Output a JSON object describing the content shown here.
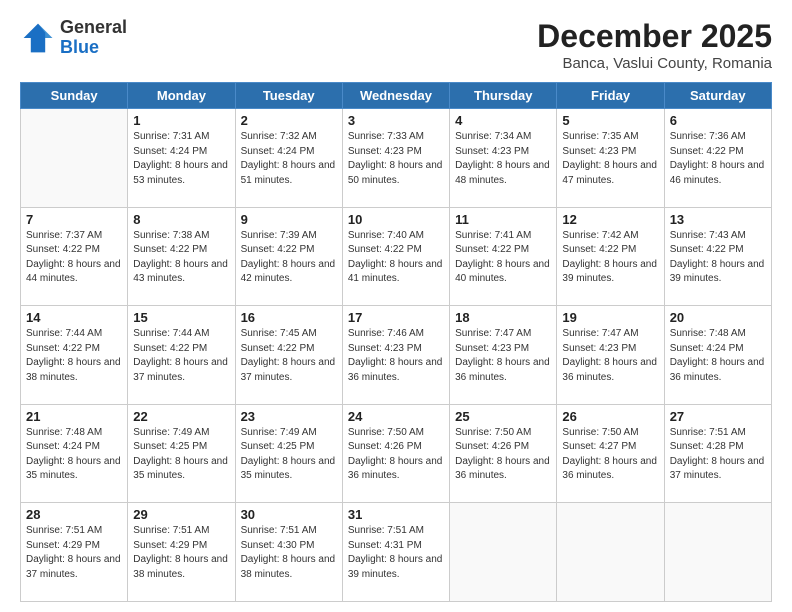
{
  "header": {
    "logo_general": "General",
    "logo_blue": "Blue",
    "title": "December 2025",
    "subtitle": "Banca, Vaslui County, Romania"
  },
  "days_of_week": [
    "Sunday",
    "Monday",
    "Tuesday",
    "Wednesday",
    "Thursday",
    "Friday",
    "Saturday"
  ],
  "weeks": [
    [
      {
        "day": "",
        "sunrise": "",
        "sunset": "",
        "daylight": ""
      },
      {
        "day": "1",
        "sunrise": "Sunrise: 7:31 AM",
        "sunset": "Sunset: 4:24 PM",
        "daylight": "Daylight: 8 hours and 53 minutes."
      },
      {
        "day": "2",
        "sunrise": "Sunrise: 7:32 AM",
        "sunset": "Sunset: 4:24 PM",
        "daylight": "Daylight: 8 hours and 51 minutes."
      },
      {
        "day": "3",
        "sunrise": "Sunrise: 7:33 AM",
        "sunset": "Sunset: 4:23 PM",
        "daylight": "Daylight: 8 hours and 50 minutes."
      },
      {
        "day": "4",
        "sunrise": "Sunrise: 7:34 AM",
        "sunset": "Sunset: 4:23 PM",
        "daylight": "Daylight: 8 hours and 48 minutes."
      },
      {
        "day": "5",
        "sunrise": "Sunrise: 7:35 AM",
        "sunset": "Sunset: 4:23 PM",
        "daylight": "Daylight: 8 hours and 47 minutes."
      },
      {
        "day": "6",
        "sunrise": "Sunrise: 7:36 AM",
        "sunset": "Sunset: 4:22 PM",
        "daylight": "Daylight: 8 hours and 46 minutes."
      }
    ],
    [
      {
        "day": "7",
        "sunrise": "Sunrise: 7:37 AM",
        "sunset": "Sunset: 4:22 PM",
        "daylight": "Daylight: 8 hours and 44 minutes."
      },
      {
        "day": "8",
        "sunrise": "Sunrise: 7:38 AM",
        "sunset": "Sunset: 4:22 PM",
        "daylight": "Daylight: 8 hours and 43 minutes."
      },
      {
        "day": "9",
        "sunrise": "Sunrise: 7:39 AM",
        "sunset": "Sunset: 4:22 PM",
        "daylight": "Daylight: 8 hours and 42 minutes."
      },
      {
        "day": "10",
        "sunrise": "Sunrise: 7:40 AM",
        "sunset": "Sunset: 4:22 PM",
        "daylight": "Daylight: 8 hours and 41 minutes."
      },
      {
        "day": "11",
        "sunrise": "Sunrise: 7:41 AM",
        "sunset": "Sunset: 4:22 PM",
        "daylight": "Daylight: 8 hours and 40 minutes."
      },
      {
        "day": "12",
        "sunrise": "Sunrise: 7:42 AM",
        "sunset": "Sunset: 4:22 PM",
        "daylight": "Daylight: 8 hours and 39 minutes."
      },
      {
        "day": "13",
        "sunrise": "Sunrise: 7:43 AM",
        "sunset": "Sunset: 4:22 PM",
        "daylight": "Daylight: 8 hours and 39 minutes."
      }
    ],
    [
      {
        "day": "14",
        "sunrise": "Sunrise: 7:44 AM",
        "sunset": "Sunset: 4:22 PM",
        "daylight": "Daylight: 8 hours and 38 minutes."
      },
      {
        "day": "15",
        "sunrise": "Sunrise: 7:44 AM",
        "sunset": "Sunset: 4:22 PM",
        "daylight": "Daylight: 8 hours and 37 minutes."
      },
      {
        "day": "16",
        "sunrise": "Sunrise: 7:45 AM",
        "sunset": "Sunset: 4:22 PM",
        "daylight": "Daylight: 8 hours and 37 minutes."
      },
      {
        "day": "17",
        "sunrise": "Sunrise: 7:46 AM",
        "sunset": "Sunset: 4:23 PM",
        "daylight": "Daylight: 8 hours and 36 minutes."
      },
      {
        "day": "18",
        "sunrise": "Sunrise: 7:47 AM",
        "sunset": "Sunset: 4:23 PM",
        "daylight": "Daylight: 8 hours and 36 minutes."
      },
      {
        "day": "19",
        "sunrise": "Sunrise: 7:47 AM",
        "sunset": "Sunset: 4:23 PM",
        "daylight": "Daylight: 8 hours and 36 minutes."
      },
      {
        "day": "20",
        "sunrise": "Sunrise: 7:48 AM",
        "sunset": "Sunset: 4:24 PM",
        "daylight": "Daylight: 8 hours and 36 minutes."
      }
    ],
    [
      {
        "day": "21",
        "sunrise": "Sunrise: 7:48 AM",
        "sunset": "Sunset: 4:24 PM",
        "daylight": "Daylight: 8 hours and 35 minutes."
      },
      {
        "day": "22",
        "sunrise": "Sunrise: 7:49 AM",
        "sunset": "Sunset: 4:25 PM",
        "daylight": "Daylight: 8 hours and 35 minutes."
      },
      {
        "day": "23",
        "sunrise": "Sunrise: 7:49 AM",
        "sunset": "Sunset: 4:25 PM",
        "daylight": "Daylight: 8 hours and 35 minutes."
      },
      {
        "day": "24",
        "sunrise": "Sunrise: 7:50 AM",
        "sunset": "Sunset: 4:26 PM",
        "daylight": "Daylight: 8 hours and 36 minutes."
      },
      {
        "day": "25",
        "sunrise": "Sunrise: 7:50 AM",
        "sunset": "Sunset: 4:26 PM",
        "daylight": "Daylight: 8 hours and 36 minutes."
      },
      {
        "day": "26",
        "sunrise": "Sunrise: 7:50 AM",
        "sunset": "Sunset: 4:27 PM",
        "daylight": "Daylight: 8 hours and 36 minutes."
      },
      {
        "day": "27",
        "sunrise": "Sunrise: 7:51 AM",
        "sunset": "Sunset: 4:28 PM",
        "daylight": "Daylight: 8 hours and 37 minutes."
      }
    ],
    [
      {
        "day": "28",
        "sunrise": "Sunrise: 7:51 AM",
        "sunset": "Sunset: 4:29 PM",
        "daylight": "Daylight: 8 hours and 37 minutes."
      },
      {
        "day": "29",
        "sunrise": "Sunrise: 7:51 AM",
        "sunset": "Sunset: 4:29 PM",
        "daylight": "Daylight: 8 hours and 38 minutes."
      },
      {
        "day": "30",
        "sunrise": "Sunrise: 7:51 AM",
        "sunset": "Sunset: 4:30 PM",
        "daylight": "Daylight: 8 hours and 38 minutes."
      },
      {
        "day": "31",
        "sunrise": "Sunrise: 7:51 AM",
        "sunset": "Sunset: 4:31 PM",
        "daylight": "Daylight: 8 hours and 39 minutes."
      },
      {
        "day": "",
        "sunrise": "",
        "sunset": "",
        "daylight": ""
      },
      {
        "day": "",
        "sunrise": "",
        "sunset": "",
        "daylight": ""
      },
      {
        "day": "",
        "sunrise": "",
        "sunset": "",
        "daylight": ""
      }
    ]
  ]
}
